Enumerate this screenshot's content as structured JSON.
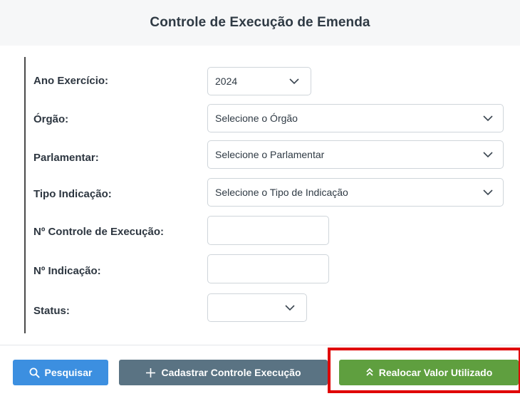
{
  "header": {
    "title": "Controle de Execução de Emenda"
  },
  "form": {
    "ano_exercicio": {
      "label": "Ano Exercício:",
      "value": "2024"
    },
    "orgao": {
      "label": "Órgão:",
      "value": "Selecione o Órgão"
    },
    "parlamentar": {
      "label": "Parlamentar:",
      "value": "Selecione o Parlamentar"
    },
    "tipo_indicacao": {
      "label": "Tipo Indicação:",
      "value": "Selecione o Tipo de Indicação"
    },
    "controle_execucao": {
      "label": "Nº Controle de Execução:",
      "value": ""
    },
    "indicacao": {
      "label": "Nº Indicação:",
      "value": ""
    },
    "status": {
      "label": "Status:",
      "value": ""
    }
  },
  "buttons": {
    "search": {
      "label": "Pesquisar",
      "icon": "search-icon"
    },
    "add": {
      "label": "Cadastrar Controle Execução",
      "icon": "plus-icon"
    },
    "realloc": {
      "label": "Realocar Valor Utilizado",
      "icon": "double-chevron-up-icon"
    }
  },
  "colors": {
    "search_button": "#3c8fe0",
    "add_button": "#5a7383",
    "realloc_button": "#5f9f3f",
    "highlight_box": "#e00000",
    "header_bg": "#f6f7f8"
  }
}
